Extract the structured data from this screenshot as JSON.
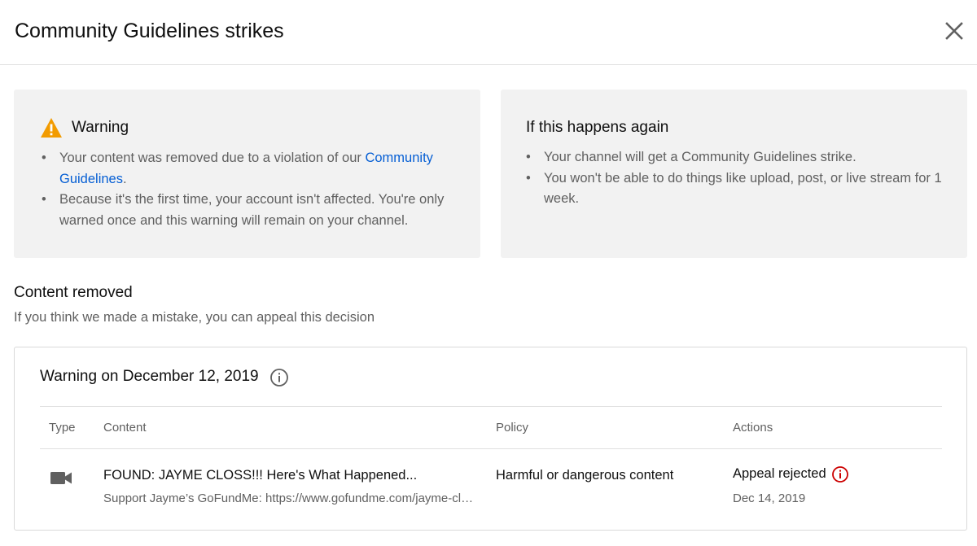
{
  "dialog": {
    "title": "Community Guidelines strikes",
    "close_icon": "close-icon"
  },
  "warning_panel": {
    "icon": "warning-triangle-icon",
    "icon_color": "#f29b00",
    "heading": "Warning",
    "bullet1_text": "Your content was removed due to a violation of our ",
    "bullet1_link": "Community Guidelines",
    "bullet1_end": ".",
    "bullet2": "Because it's the first time, your account isn't affected. You're only warned once and this warning will remain on your channel."
  },
  "again_panel": {
    "heading": "If this happens again",
    "bullets": [
      "Your channel will get a Community Guidelines strike.",
      "You won't be able to do things like upload, post, or live stream for 1 week."
    ]
  },
  "content_removed": {
    "title": "Content removed",
    "subtitle": "If you think we made a mistake, you can appeal this decision"
  },
  "strike_card": {
    "title": "Warning on December 12, 2019",
    "info_icon": "info-icon",
    "columns": {
      "type": "Type",
      "content": "Content",
      "policy": "Policy",
      "actions": "Actions"
    },
    "row": {
      "type_icon": "video-camera-icon",
      "title": "FOUND: JAYME CLOSS!!! Here's What Happened...",
      "description": "Support Jayme’s GoFundMe: https://www.gofundme.com/jayme-closs",
      "policy": "Harmful or dangerous content",
      "status": "Appeal rejected",
      "status_icon": "alert-info-icon",
      "status_icon_color": "#cc0000",
      "date": "Dec 14, 2019"
    }
  },
  "colors": {
    "link": "#065fd4",
    "panel_bg": "#f2f2f2",
    "secondary_text": "#606060"
  }
}
